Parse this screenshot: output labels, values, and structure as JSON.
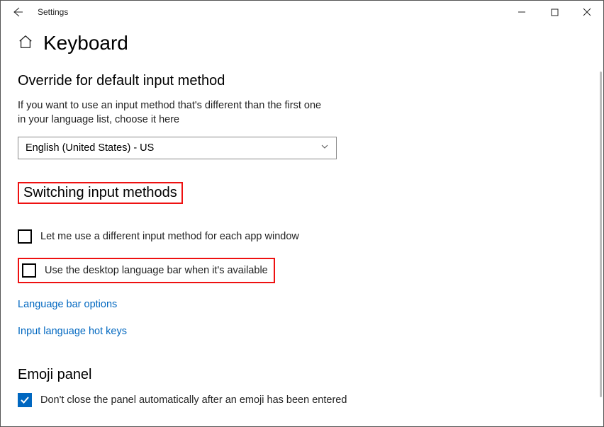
{
  "window": {
    "title": "Settings"
  },
  "page": {
    "title": "Keyboard"
  },
  "section_override": {
    "title": "Override for default input method",
    "desc": "If you want to use an input method that's different than the first one in your language list, choose it here",
    "dropdown_value": "English (United States) - US"
  },
  "section_switching": {
    "title": "Switching input methods",
    "checkbox1_label": "Let me use a different input method for each app window",
    "checkbox2_label": "Use the desktop language bar when it's available",
    "link1": "Language bar options",
    "link2": "Input language hot keys"
  },
  "section_emoji": {
    "title": "Emoji panel",
    "checkbox_label": "Don't close the panel automatically after an emoji has been entered"
  }
}
